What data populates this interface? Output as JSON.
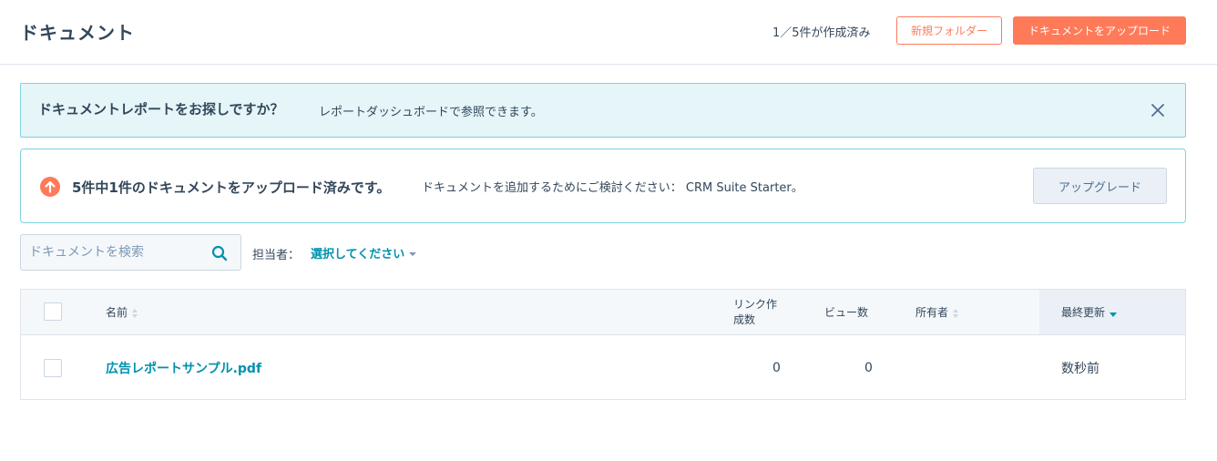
{
  "header": {
    "title": "ドキュメント",
    "usage": "1／5件が作成済み",
    "new_folder_label": "新規フォルダー",
    "upload_label": "ドキュメントをアップロード"
  },
  "info_banner": {
    "title": "ドキュメントレポートをお探しですか？",
    "text": "レポートダッシュボードで参照できます。",
    "close_icon": "close-icon"
  },
  "upgrade_banner": {
    "icon": "arrow-up-circle-icon",
    "title": "5件中1件のドキュメントをアップロード済みです。",
    "text": "ドキュメントを追加するためにご検討ください： CRM Suite Starter。",
    "button_label": "アップグレード"
  },
  "filters": {
    "search_placeholder": "ドキュメントを検索",
    "search_value": "",
    "owner_label": "担当者：",
    "owner_value": "選択してください"
  },
  "table": {
    "columns": {
      "name": "名前",
      "link_count_line1": "リンク作",
      "link_count_line2": "成数",
      "views": "ビュー数",
      "owner": "所有者",
      "last_updated": "最終更新"
    },
    "rows": [
      {
        "name": "広告レポートサンプル.pdf",
        "link_count": "0",
        "views": "0",
        "owner": "",
        "last_updated": "数秒前"
      }
    ]
  },
  "colors": {
    "accent": "#ff7a59",
    "link": "#0091ae",
    "text": "#33475b",
    "info_bg": "#e5f5f8",
    "info_border": "#7fd1de"
  }
}
